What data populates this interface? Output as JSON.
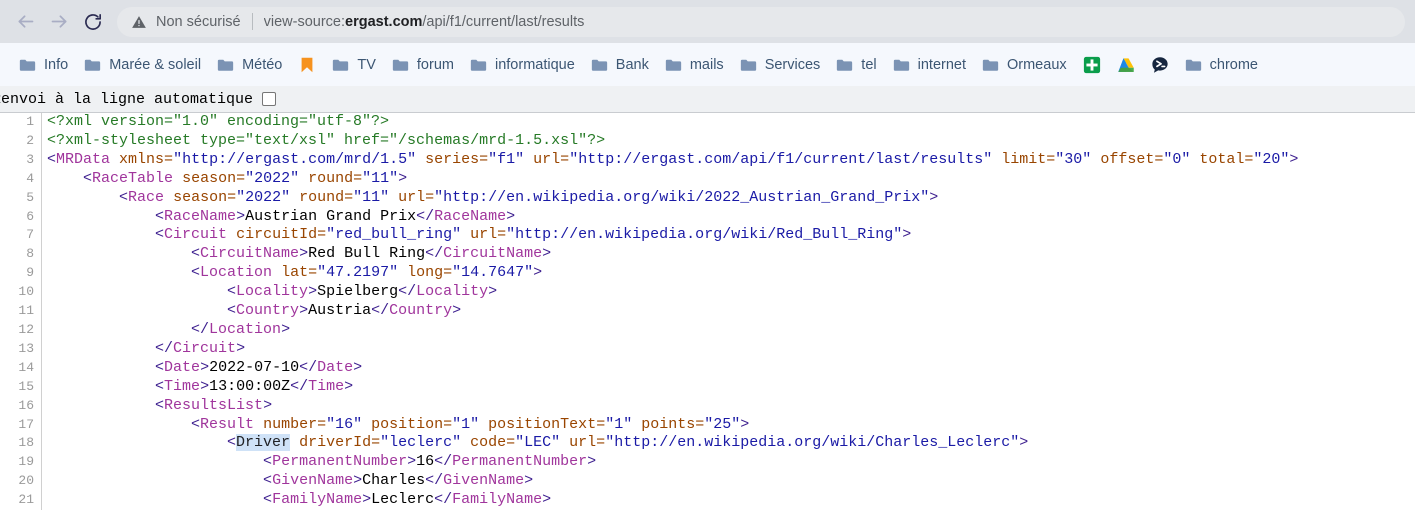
{
  "browser": {
    "nav": {
      "back_icon": "arrow-left-icon",
      "forward_icon": "arrow-right-icon",
      "reload_icon": "reload-icon"
    },
    "omnibox": {
      "warning_icon": "warning-triangle-icon",
      "security_text": "Non sécurisé",
      "url_scheme": "view-source:",
      "url_host": "ergast.com",
      "url_path": "/api/f1/current/last/results"
    },
    "bookmarks": [
      {
        "label": "Info",
        "icon": "folder-icon"
      },
      {
        "label": "Marée & soleil",
        "icon": "folder-icon"
      },
      {
        "label": "Météo",
        "icon": "folder-icon"
      },
      {
        "label": "",
        "icon": "orange-bookmark-icon"
      },
      {
        "label": "TV",
        "icon": "folder-icon"
      },
      {
        "label": "forum",
        "icon": "folder-icon"
      },
      {
        "label": "informatique",
        "icon": "folder-icon"
      },
      {
        "label": "Bank",
        "icon": "folder-icon"
      },
      {
        "label": "mails",
        "icon": "folder-icon"
      },
      {
        "label": "Services",
        "icon": "folder-icon"
      },
      {
        "label": "tel",
        "icon": "folder-icon"
      },
      {
        "label": "internet",
        "icon": "folder-icon"
      },
      {
        "label": "Ormeaux",
        "icon": "folder-icon"
      },
      {
        "label": "",
        "icon": "green-cross-icon"
      },
      {
        "label": "",
        "icon": "google-drive-icon"
      },
      {
        "label": "",
        "icon": "dark-chat-icon"
      },
      {
        "label": "chrome",
        "icon": "folder-icon"
      }
    ]
  },
  "viewsource": {
    "wrap_label": "Renvoi à la ligne automatique",
    "wrap_checked": false,
    "lines": [
      {
        "n": "1",
        "tokens": [
          {
            "c": "pi",
            "t": "<?xml version=\"1.0\" encoding=\"utf-8\"?>"
          }
        ]
      },
      {
        "n": "2",
        "tokens": [
          {
            "c": "pi",
            "t": "<?xml-stylesheet type=\"text/xsl\" href=\"/schemas/mrd-1.5.xsl\"?>"
          }
        ]
      },
      {
        "n": "3",
        "tokens": [
          {
            "c": "brk",
            "t": "<"
          },
          {
            "c": "tag",
            "t": "MRData"
          },
          {
            "c": "txt",
            "t": " "
          },
          {
            "c": "attr",
            "t": "xmlns="
          },
          {
            "c": "val",
            "t": "\"http://ergast.com/mrd/1.5\""
          },
          {
            "c": "txt",
            "t": " "
          },
          {
            "c": "attr",
            "t": "series="
          },
          {
            "c": "val",
            "t": "\"f1\""
          },
          {
            "c": "txt",
            "t": " "
          },
          {
            "c": "attr",
            "t": "url="
          },
          {
            "c": "val",
            "t": "\"http://ergast.com/api/f1/current/last/results\""
          },
          {
            "c": "txt",
            "t": " "
          },
          {
            "c": "attr",
            "t": "limit="
          },
          {
            "c": "val",
            "t": "\"30\""
          },
          {
            "c": "txt",
            "t": " "
          },
          {
            "c": "attr",
            "t": "offset="
          },
          {
            "c": "val",
            "t": "\"0\""
          },
          {
            "c": "txt",
            "t": " "
          },
          {
            "c": "attr",
            "t": "total="
          },
          {
            "c": "val",
            "t": "\"20\""
          },
          {
            "c": "brk",
            "t": ">"
          }
        ]
      },
      {
        "n": "4",
        "tokens": [
          {
            "c": "txt",
            "t": "    "
          },
          {
            "c": "brk",
            "t": "<"
          },
          {
            "c": "tag",
            "t": "RaceTable"
          },
          {
            "c": "txt",
            "t": " "
          },
          {
            "c": "attr",
            "t": "season="
          },
          {
            "c": "val",
            "t": "\"2022\""
          },
          {
            "c": "txt",
            "t": " "
          },
          {
            "c": "attr",
            "t": "round="
          },
          {
            "c": "val",
            "t": "\"11\""
          },
          {
            "c": "brk",
            "t": ">"
          }
        ]
      },
      {
        "n": "5",
        "tokens": [
          {
            "c": "txt",
            "t": "        "
          },
          {
            "c": "brk",
            "t": "<"
          },
          {
            "c": "tag",
            "t": "Race"
          },
          {
            "c": "txt",
            "t": " "
          },
          {
            "c": "attr",
            "t": "season="
          },
          {
            "c": "val",
            "t": "\"2022\""
          },
          {
            "c": "txt",
            "t": " "
          },
          {
            "c": "attr",
            "t": "round="
          },
          {
            "c": "val",
            "t": "\"11\""
          },
          {
            "c": "txt",
            "t": " "
          },
          {
            "c": "attr",
            "t": "url="
          },
          {
            "c": "val",
            "t": "\"http://en.wikipedia.org/wiki/2022_Austrian_Grand_Prix\""
          },
          {
            "c": "brk",
            "t": ">"
          }
        ]
      },
      {
        "n": "6",
        "tokens": [
          {
            "c": "txt",
            "t": "            "
          },
          {
            "c": "brk",
            "t": "<"
          },
          {
            "c": "tag",
            "t": "RaceName"
          },
          {
            "c": "brk",
            "t": ">"
          },
          {
            "c": "txt",
            "t": "Austrian Grand Prix"
          },
          {
            "c": "brk",
            "t": "</"
          },
          {
            "c": "tag",
            "t": "RaceName"
          },
          {
            "c": "brk",
            "t": ">"
          }
        ]
      },
      {
        "n": "7",
        "tokens": [
          {
            "c": "txt",
            "t": "            "
          },
          {
            "c": "brk",
            "t": "<"
          },
          {
            "c": "tag",
            "t": "Circuit"
          },
          {
            "c": "txt",
            "t": " "
          },
          {
            "c": "attr",
            "t": "circuitId="
          },
          {
            "c": "val",
            "t": "\"red_bull_ring\""
          },
          {
            "c": "txt",
            "t": " "
          },
          {
            "c": "attr",
            "t": "url="
          },
          {
            "c": "val",
            "t": "\"http://en.wikipedia.org/wiki/Red_Bull_Ring\""
          },
          {
            "c": "brk",
            "t": ">"
          }
        ]
      },
      {
        "n": "8",
        "tokens": [
          {
            "c": "txt",
            "t": "                "
          },
          {
            "c": "brk",
            "t": "<"
          },
          {
            "c": "tag",
            "t": "CircuitName"
          },
          {
            "c": "brk",
            "t": ">"
          },
          {
            "c": "txt",
            "t": "Red Bull Ring"
          },
          {
            "c": "brk",
            "t": "</"
          },
          {
            "c": "tag",
            "t": "CircuitName"
          },
          {
            "c": "brk",
            "t": ">"
          }
        ]
      },
      {
        "n": "9",
        "tokens": [
          {
            "c": "txt",
            "t": "                "
          },
          {
            "c": "brk",
            "t": "<"
          },
          {
            "c": "tag",
            "t": "Location"
          },
          {
            "c": "txt",
            "t": " "
          },
          {
            "c": "attr",
            "t": "lat="
          },
          {
            "c": "val",
            "t": "\"47.2197\""
          },
          {
            "c": "txt",
            "t": " "
          },
          {
            "c": "attr",
            "t": "long="
          },
          {
            "c": "val",
            "t": "\"14.7647\""
          },
          {
            "c": "brk",
            "t": ">"
          }
        ]
      },
      {
        "n": "10",
        "tokens": [
          {
            "c": "txt",
            "t": "                    "
          },
          {
            "c": "brk",
            "t": "<"
          },
          {
            "c": "tag",
            "t": "Locality"
          },
          {
            "c": "brk",
            "t": ">"
          },
          {
            "c": "txt",
            "t": "Spielberg"
          },
          {
            "c": "brk",
            "t": "</"
          },
          {
            "c": "tag",
            "t": "Locality"
          },
          {
            "c": "brk",
            "t": ">"
          }
        ]
      },
      {
        "n": "11",
        "tokens": [
          {
            "c": "txt",
            "t": "                    "
          },
          {
            "c": "brk",
            "t": "<"
          },
          {
            "c": "tag",
            "t": "Country"
          },
          {
            "c": "brk",
            "t": ">"
          },
          {
            "c": "txt",
            "t": "Austria"
          },
          {
            "c": "brk",
            "t": "</"
          },
          {
            "c": "tag",
            "t": "Country"
          },
          {
            "c": "brk",
            "t": ">"
          }
        ]
      },
      {
        "n": "12",
        "tokens": [
          {
            "c": "txt",
            "t": "                "
          },
          {
            "c": "brk",
            "t": "</"
          },
          {
            "c": "tag",
            "t": "Location"
          },
          {
            "c": "brk",
            "t": ">"
          }
        ]
      },
      {
        "n": "13",
        "tokens": [
          {
            "c": "txt",
            "t": "            "
          },
          {
            "c": "brk",
            "t": "</"
          },
          {
            "c": "tag",
            "t": "Circuit"
          },
          {
            "c": "brk",
            "t": ">"
          }
        ]
      },
      {
        "n": "14",
        "tokens": [
          {
            "c": "txt",
            "t": "            "
          },
          {
            "c": "brk",
            "t": "<"
          },
          {
            "c": "tag",
            "t": "Date"
          },
          {
            "c": "brk",
            "t": ">"
          },
          {
            "c": "txt",
            "t": "2022-07-10"
          },
          {
            "c": "brk",
            "t": "</"
          },
          {
            "c": "tag",
            "t": "Date"
          },
          {
            "c": "brk",
            "t": ">"
          }
        ]
      },
      {
        "n": "15",
        "tokens": [
          {
            "c": "txt",
            "t": "            "
          },
          {
            "c": "brk",
            "t": "<"
          },
          {
            "c": "tag",
            "t": "Time"
          },
          {
            "c": "brk",
            "t": ">"
          },
          {
            "c": "txt",
            "t": "13:00:00Z"
          },
          {
            "c": "brk",
            "t": "</"
          },
          {
            "c": "tag",
            "t": "Time"
          },
          {
            "c": "brk",
            "t": ">"
          }
        ]
      },
      {
        "n": "16",
        "tokens": [
          {
            "c": "txt",
            "t": "            "
          },
          {
            "c": "brk",
            "t": "<"
          },
          {
            "c": "tag",
            "t": "ResultsList"
          },
          {
            "c": "brk",
            "t": ">"
          }
        ]
      },
      {
        "n": "17",
        "tokens": [
          {
            "c": "txt",
            "t": "                "
          },
          {
            "c": "brk",
            "t": "<"
          },
          {
            "c": "tag",
            "t": "Result"
          },
          {
            "c": "txt",
            "t": " "
          },
          {
            "c": "attr",
            "t": "number="
          },
          {
            "c": "val",
            "t": "\"16\""
          },
          {
            "c": "txt",
            "t": " "
          },
          {
            "c": "attr",
            "t": "position="
          },
          {
            "c": "val",
            "t": "\"1\""
          },
          {
            "c": "txt",
            "t": " "
          },
          {
            "c": "attr",
            "t": "positionText="
          },
          {
            "c": "val",
            "t": "\"1\""
          },
          {
            "c": "txt",
            "t": " "
          },
          {
            "c": "attr",
            "t": "points="
          },
          {
            "c": "val",
            "t": "\"25\""
          },
          {
            "c": "brk",
            "t": ">"
          }
        ]
      },
      {
        "n": "18",
        "tokens": [
          {
            "c": "txt",
            "t": "                    "
          },
          {
            "c": "brk",
            "t": "<"
          },
          {
            "c": "sel",
            "t": "Driver"
          },
          {
            "c": "txt",
            "t": " "
          },
          {
            "c": "attr",
            "t": "driverId="
          },
          {
            "c": "val",
            "t": "\"leclerc\""
          },
          {
            "c": "txt",
            "t": " "
          },
          {
            "c": "attr",
            "t": "code="
          },
          {
            "c": "val",
            "t": "\"LEC\""
          },
          {
            "c": "txt",
            "t": " "
          },
          {
            "c": "attr",
            "t": "url="
          },
          {
            "c": "val",
            "t": "\"http://en.wikipedia.org/wiki/Charles_Leclerc\""
          },
          {
            "c": "brk",
            "t": ">"
          }
        ]
      },
      {
        "n": "19",
        "tokens": [
          {
            "c": "txt",
            "t": "                        "
          },
          {
            "c": "brk",
            "t": "<"
          },
          {
            "c": "tag",
            "t": "PermanentNumber"
          },
          {
            "c": "brk",
            "t": ">"
          },
          {
            "c": "txt",
            "t": "16"
          },
          {
            "c": "brk",
            "t": "</"
          },
          {
            "c": "tag",
            "t": "PermanentNumber"
          },
          {
            "c": "brk",
            "t": ">"
          }
        ]
      },
      {
        "n": "20",
        "tokens": [
          {
            "c": "txt",
            "t": "                        "
          },
          {
            "c": "brk",
            "t": "<"
          },
          {
            "c": "tag",
            "t": "GivenName"
          },
          {
            "c": "brk",
            "t": ">"
          },
          {
            "c": "txt",
            "t": "Charles"
          },
          {
            "c": "brk",
            "t": "</"
          },
          {
            "c": "tag",
            "t": "GivenName"
          },
          {
            "c": "brk",
            "t": ">"
          }
        ]
      },
      {
        "n": "21",
        "tokens": [
          {
            "c": "txt",
            "t": "                        "
          },
          {
            "c": "brk",
            "t": "<"
          },
          {
            "c": "tag",
            "t": "FamilyName"
          },
          {
            "c": "brk",
            "t": ">"
          },
          {
            "c": "txt",
            "t": "Leclerc"
          },
          {
            "c": "brk",
            "t": "</"
          },
          {
            "c": "tag",
            "t": "FamilyName"
          },
          {
            "c": "brk",
            "t": ">"
          }
        ]
      }
    ]
  }
}
